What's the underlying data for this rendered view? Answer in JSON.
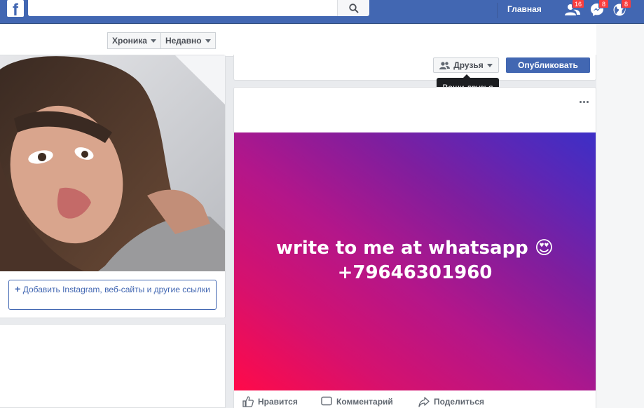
{
  "topbar": {
    "logo": "f",
    "search": {
      "value": "",
      "placeholder": ""
    },
    "home_label": "Главная",
    "friend_requests_badge": "16",
    "messages_badge": "8",
    "notifications_badge": "8"
  },
  "timeline": {
    "tab_timeline": "Хроника",
    "tab_recent": "Недавно"
  },
  "intro": {
    "add_links_label": "Добавить Instagram, веб-сайты и другие ссылки",
    "add_links_plus": "+"
  },
  "composer": {
    "audience_label": "Друзья",
    "publish_label": "Опубликовать",
    "tooltip": "Ваши друзья"
  },
  "post": {
    "text_line1": "write to me at whatsapp 😍",
    "text_line2": "+79646301960",
    "like_label": "Нравится",
    "comment_label": "Комментарий",
    "share_label": "Поделиться"
  },
  "colors": {
    "brand": "#4267b2",
    "gradient_start": "#ff0a49",
    "gradient_end": "#3c2fc6",
    "badge": "#fa3e3e"
  },
  "icons": [
    "facebook-logo-icon",
    "search-icon",
    "friend-requests-icon",
    "messenger-icon",
    "globe-notifications-icon",
    "caret-down-icon",
    "friends-audience-icon",
    "more-options-icon",
    "like-icon",
    "comment-icon",
    "share-icon"
  ]
}
